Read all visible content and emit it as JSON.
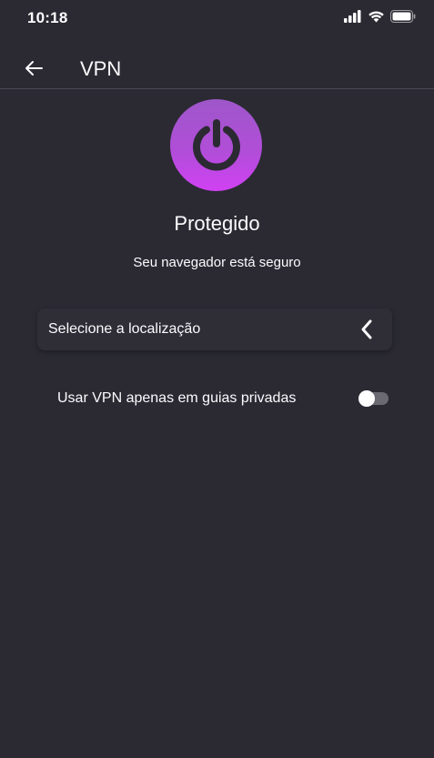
{
  "status_bar": {
    "time": "10:18",
    "icons": [
      "signal-icon",
      "wifi-icon",
      "battery-icon"
    ]
  },
  "header": {
    "title": "VPN",
    "back_icon": "back-arrow-icon"
  },
  "vpn": {
    "power_icon": "power-icon",
    "status_title": "Protegido",
    "status_subtitle": "Seu navegador está seguro"
  },
  "location": {
    "label": "Selecione a localização",
    "icon": "chevron-left-icon"
  },
  "private_tabs": {
    "label": "Usar VPN apenas em guias privadas",
    "enabled": false
  },
  "colors": {
    "background": "#2b2a33",
    "accent_gradient_start": "#9e57c9",
    "accent_gradient_end": "#d141f3",
    "text": "#fbfbfe"
  }
}
